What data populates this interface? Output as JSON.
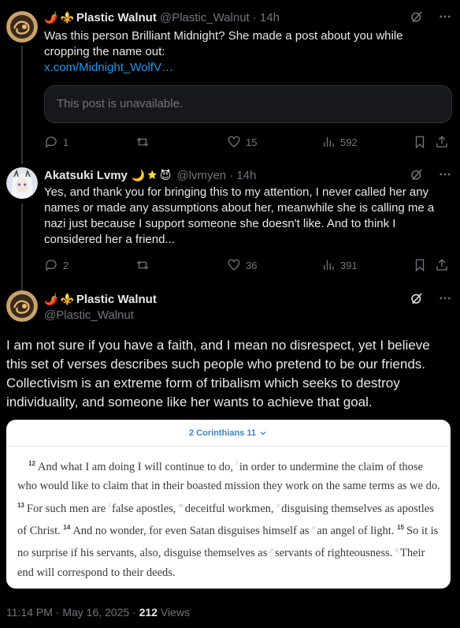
{
  "posts": [
    {
      "name": "Plastic Walnut",
      "name_emoji": [
        "🌶️",
        "⚜️"
      ],
      "handle": "@Plastic_Walnut",
      "time": "· 14h",
      "text": "Was this person Brilliant Midnight?  She made a post about you while cropping the name out:",
      "link": "x.com/Midnight_WolfV…",
      "quote_unavailable": "This post is unavailable.",
      "stats": {
        "replies": "1",
        "reposts": "",
        "likes": "15",
        "views": "592"
      }
    },
    {
      "name": "Akatsuki Lvmy",
      "name_emoji": [
        "🌙",
        "⭐",
        "😈"
      ],
      "handle": "@lvmyen",
      "time": "· 14h",
      "text": "Yes, and thank you for bringing this to my attention, I never called her any names or made any assumptions about her, meanwhile she is calling me a nazi just because I support someone she doesn't like. And to think I considered her a friend...",
      "stats": {
        "replies": "2",
        "reposts": "",
        "likes": "36",
        "views": "391"
      }
    }
  ],
  "focus": {
    "name": "Plastic Walnut",
    "name_emoji": [
      "🌶️",
      "⚜️"
    ],
    "handle": "@Plastic_Walnut",
    "text": "I am not sure if you have a faith, and I mean no disrespect, yet I believe this set of verses describes such people who pretend to be our friends. Collectivism is an extreme form of tribalism which seeks to destroy individuality, and someone like her wants to achieve that goal.",
    "image": {
      "header": "2 Corinthians 11",
      "verses": [
        {
          "num": "12",
          "parts": [
            {
              "t": "And what I am doing I will continue to do, "
            },
            {
              "x": "l"
            },
            {
              "t": "in order to undermine the claim of those who would like to claim that in their boasted mission they work on the same terms as we do. "
            }
          ]
        },
        {
          "num": "13",
          "parts": [
            {
              "t": "For such men are "
            },
            {
              "x": "l"
            },
            {
              "t": "false apostles, "
            },
            {
              "x": "m"
            },
            {
              "t": "deceitful workmen, "
            },
            {
              "x": "n"
            },
            {
              "t": "disguising themselves as apostles of Christ. "
            }
          ]
        },
        {
          "num": "14",
          "parts": [
            {
              "t": "And no wonder, for even Satan disguises himself as "
            },
            {
              "x": "o"
            },
            {
              "t": "an angel of light. "
            }
          ]
        },
        {
          "num": "15",
          "parts": [
            {
              "t": "So it is no surprise if his servants, also, disguise themselves as "
            },
            {
              "x": "p"
            },
            {
              "t": "servants of righteousness. "
            },
            {
              "x": "q"
            },
            {
              "t": "Their end will correspond to their deeds."
            }
          ]
        }
      ]
    },
    "timestamp": "11:14 PM · May 16, 2025 · ",
    "views_count": "212",
    "views_label": " Views"
  }
}
